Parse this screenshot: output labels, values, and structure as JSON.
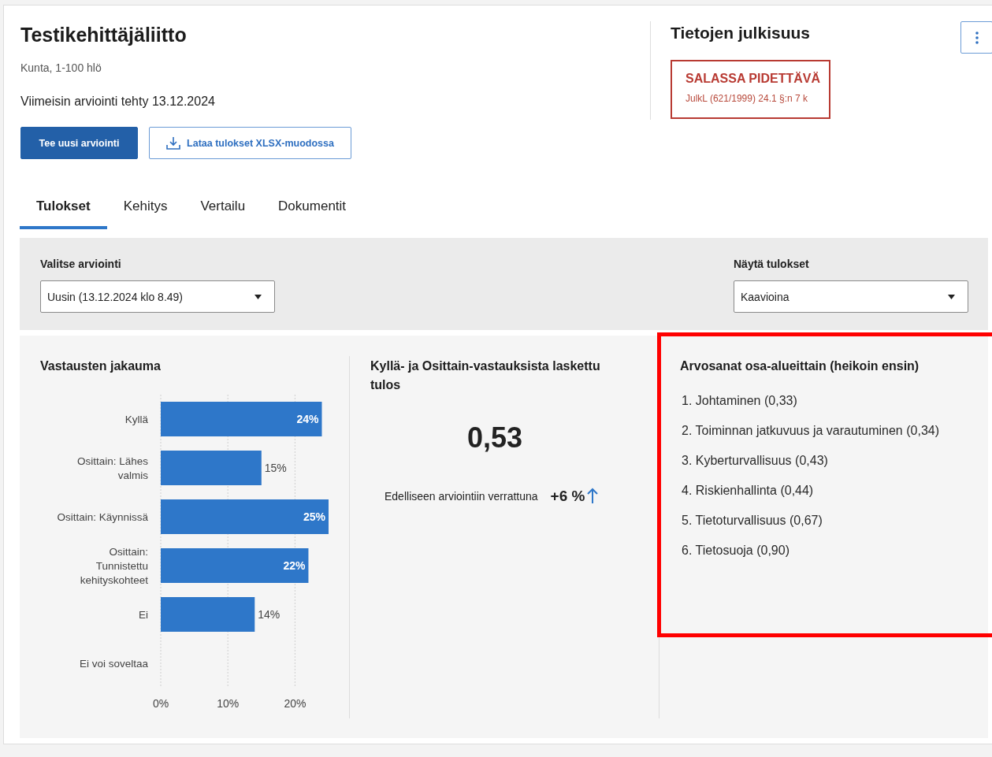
{
  "header": {
    "title": "Testikehittäjäliitto",
    "subtitle": "Kunta, 1-100 hlö",
    "last_assessment": "Viimeisin arviointi tehty 13.12.2024",
    "buttons": [
      {
        "label": "Tee uusi arviointi",
        "kind": "primary"
      },
      {
        "label": "Lataa tulokset XLSX-muodossa",
        "kind": "download"
      }
    ]
  },
  "publicity": {
    "title": "Tietojen julkisuus",
    "status": "SALASSA PIDETTÄVÄ",
    "basis": "JulkL (621/1999) 24.1 §:n 7 k"
  },
  "tabs": [
    {
      "label": "Tulokset",
      "selected": true
    },
    {
      "label": "Kehitys",
      "selected": false
    },
    {
      "label": "Vertailu",
      "selected": false
    },
    {
      "label": "Dokumentit",
      "selected": false
    }
  ],
  "filters": [
    {
      "label": "Valitse arviointi",
      "value": "Uusin (13.12.2024 klo 8.49)"
    },
    {
      "label": "Näytä tulokset",
      "value": "Kaavioina"
    }
  ],
  "distribution": {
    "title": "Vastausten jakauma",
    "chart_data": {
      "type": "bar",
      "orientation": "horizontal",
      "categories": [
        "Kyllä",
        "Osittain: Lähes valmis",
        "Osittain: Käynnissä",
        "Osittain: Tunnistettu kehityskohteet",
        "Ei",
        "Ei voi soveltaa"
      ],
      "series": [
        {
          "color": "#2e77c9",
          "values": [
            24,
            15,
            25,
            22,
            14,
            null
          ]
        }
      ],
      "xlim": [
        0,
        25
      ],
      "xticks": [
        {
          "value": 0,
          "label": "0%"
        },
        {
          "value": 10,
          "label": "10%"
        },
        {
          "value": 20,
          "label": "20%"
        }
      ],
      "value_labels": [
        "24%",
        "15%",
        "25%",
        "22%",
        "14%",
        null
      ]
    }
  },
  "score": {
    "title": "Kyllä- ja Osittain-vastauksista laskettu tulos",
    "value": "0,53",
    "comparison_label": "Edelliseen arviointiin verrattuna",
    "change": "+6 %"
  },
  "ratings": {
    "title": "Arvosanat osa-alueittain (heikoin ensin)",
    "highlighted": true,
    "items": [
      "1. Johtaminen (0,33)",
      "2. Toiminnan jatkuvuus ja varautuminen (0,34)",
      "3. Kyberturvallisuus (0,43)",
      "4. Riskienhallinta (0,44)",
      "5. Tietoturvallisuus (0,67)",
      "6. Tietosuoja (0,90)"
    ]
  }
}
